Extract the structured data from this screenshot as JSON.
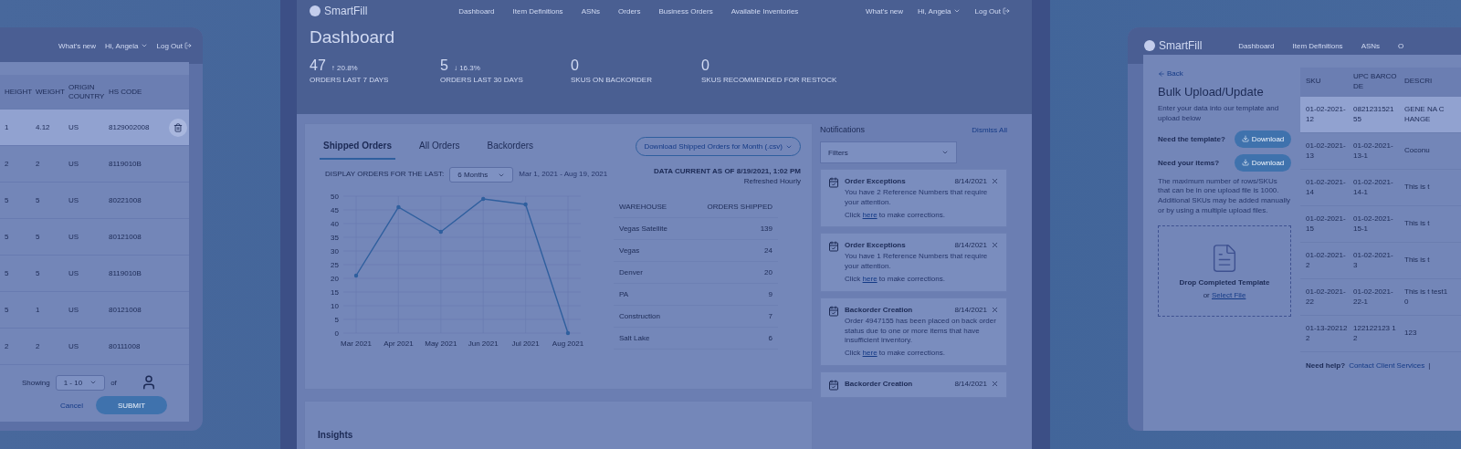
{
  "left_window": {
    "nav_links": [
      "What's new",
      "Hi, Angela",
      "Log Out"
    ],
    "table": {
      "columns": [
        "HEIGHT",
        "WEIGHT",
        "ORIGIN COUNTRY",
        "HS CODE"
      ],
      "rows": [
        {
          "cells": [
            "1",
            "4.12",
            "US",
            "8129002008"
          ],
          "selected": true
        },
        {
          "cells": [
            "2",
            "2",
            "US",
            "8119010B"
          ],
          "selected": false
        },
        {
          "cells": [
            "5",
            "5",
            "US",
            "80221008"
          ],
          "selected": false
        },
        {
          "cells": [
            "5",
            "5",
            "US",
            "80121008"
          ],
          "selected": false
        },
        {
          "cells": [
            "5",
            "5",
            "US",
            "8119010B"
          ],
          "selected": false
        },
        {
          "cells": [
            "5",
            "1",
            "US",
            "80121008"
          ],
          "selected": false
        },
        {
          "cells": [
            "2",
            "2",
            "US",
            "80111008"
          ],
          "selected": false
        }
      ]
    },
    "pagination": {
      "label": "Showing",
      "page_size": "1 - 10",
      "of": "of"
    },
    "cancel": "Cancel",
    "submit": "SUBMIT"
  },
  "dashboard": {
    "logo": "SmartFill",
    "nav": [
      "Dashboard",
      "Item Definitions",
      "ASNs",
      "Orders",
      "Business Orders",
      "Available Inventories"
    ],
    "user_links": [
      "What's new",
      "Hi, Angela",
      "Log Out"
    ],
    "title": "Dashboard",
    "stats": [
      {
        "value": "47",
        "change": "↑ 20.8%",
        "label": "ORDERS LAST 7 DAYS"
      },
      {
        "value": "5",
        "change": "↓ 16.3%",
        "label": "ORDERS LAST 30 DAYS"
      },
      {
        "value": "0",
        "label": "SKUS ON BACKORDER"
      },
      {
        "value": "0",
        "label": "SKUS RECOMMENDED FOR RESTOCK"
      }
    ],
    "tabs": [
      {
        "label": "Shipped Orders",
        "selected": true
      },
      {
        "label": "All Orders",
        "selected": false
      },
      {
        "label": "Backorders",
        "selected": false
      }
    ],
    "download_button": "Download Shipped Orders for Month (.csv)",
    "range_label": "DISPLAY ORDERS FOR THE LAST:",
    "range_select": "6 Months",
    "date_range": "Mar 1, 2021 - Aug 19, 2021",
    "data_current": "DATA CURRENT AS OF 8/19/2021, 1:02 PM",
    "refresh_note": "Refreshed Hourly",
    "chart_data": {
      "type": "line",
      "categories": [
        "Mar 2021",
        "Apr 2021",
        "May 2021",
        "Jun 2021",
        "Jul 2021",
        "Aug 2021"
      ],
      "series": [
        {
          "color": "#2f5f9e",
          "values": [
            21,
            46,
            37,
            49,
            47,
            0
          ]
        }
      ],
      "grid": true,
      "ylim": [
        0,
        50
      ],
      "yticks": [
        0,
        5,
        10,
        15,
        20,
        25,
        30,
        35,
        40,
        45,
        50
      ]
    },
    "warehouse_table": {
      "columns": [
        "WAREHOUSE",
        "ORDERS SHIPPED"
      ],
      "rows": [
        [
          "Vegas Satellite",
          "139"
        ],
        [
          "Vegas",
          "24"
        ],
        [
          "Denver",
          "20"
        ],
        [
          "PA",
          "9"
        ],
        [
          "Construction",
          "7"
        ],
        [
          "Salt Lake",
          "6"
        ]
      ]
    },
    "notifications": {
      "title": "Notifications",
      "dismiss_all": "Dismiss All",
      "filter_placeholder": "Filters",
      "items": [
        {
          "title": "Order Exceptions",
          "date": "8/14/2021",
          "message": "You have 2 Reference Numbers that require your attention.",
          "link_prefix": "Click",
          "link": "here",
          "link_suffix": "to make corrections."
        },
        {
          "title": "Order Exceptions",
          "date": "8/14/2021",
          "message": "You have 1 Reference Numbers that require your attention.",
          "link_prefix": "Click",
          "link": "here",
          "link_suffix": "to make corrections."
        },
        {
          "title": "Backorder Creation",
          "date": "8/14/2021",
          "message": "Order 4947155 has been placed on back order status due to one or more items that have insufficient inventory.",
          "link_prefix": "Click",
          "link": "here",
          "link_suffix": "to make corrections."
        },
        {
          "title": "Backorder Creation",
          "date": "8/14/2021"
        }
      ]
    },
    "insights_title": "Insights"
  },
  "bulk_upload": {
    "logo": "SmartFill",
    "nav": [
      "Dashboard",
      "Item Definitions",
      "ASNs",
      "O"
    ],
    "back_link": "Back",
    "title": "Bulk Upload/Update",
    "intro": "Enter your data into our template and upload below",
    "downloads": [
      {
        "label": "Need the template?",
        "button": "Download"
      },
      {
        "label": "Need your items?",
        "button": "Download"
      }
    ],
    "limit_note": "The maximum number of rows/SKUs that can be in one upload file is 1000. Additional SKUs may be added manually or by using a multiple upload files.",
    "dropzone": {
      "title": "Drop Completed Template",
      "prefix": "or",
      "link": "Select File"
    },
    "table": {
      "columns": [
        "SKU",
        "UPC BARCODE",
        "DESCRI"
      ],
      "rows": [
        {
          "cells": [
            "01-02-2021-12",
            "082123152155",
            "GENE NA CHANGE"
          ],
          "selected": true
        },
        {
          "cells": [
            "01-02-2021-13",
            "01-02-2021-13-1",
            "Coconu"
          ],
          "selected": false
        },
        {
          "cells": [
            "01-02-2021-14",
            "01-02-2021-14-1",
            "This is t"
          ],
          "selected": false
        },
        {
          "cells": [
            "01-02-2021-15",
            "01-02-2021-15-1",
            "This is t"
          ],
          "selected": false
        },
        {
          "cells": [
            "01-02-2021-2",
            "01-02-2021-3",
            "This is t"
          ],
          "selected": false
        },
        {
          "cells": [
            "01-02-2021-22",
            "01-02-2021-22-1",
            "This is t test10"
          ],
          "selected": false
        },
        {
          "cells": [
            "01-13-202122",
            "122122123 12",
            "123"
          ],
          "selected": false
        }
      ]
    },
    "help": {
      "label": "Need help?",
      "link": "Contact Client Services",
      "separator": "|"
    }
  }
}
